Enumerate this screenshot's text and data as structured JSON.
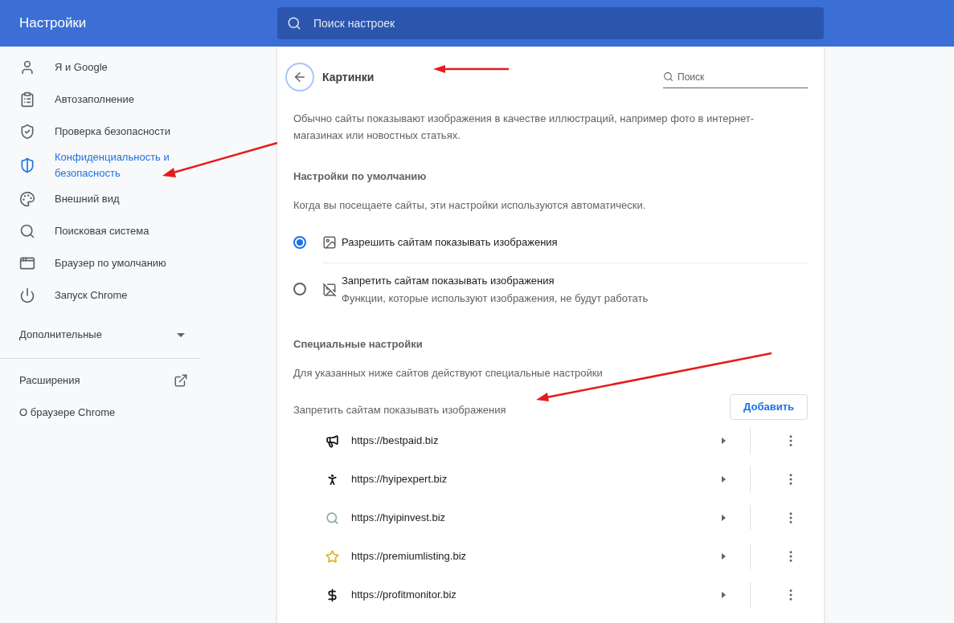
{
  "header": {
    "title": "Настройки",
    "search_placeholder": "Поиск настроек"
  },
  "sidebar": {
    "items": [
      {
        "label": "Я и Google",
        "selected": false
      },
      {
        "label": "Автозаполнение",
        "selected": false
      },
      {
        "label": "Проверка безопасности",
        "selected": false
      },
      {
        "label": "Конфиденциальность и безопасность",
        "selected": true
      },
      {
        "label": "Внешний вид",
        "selected": false
      },
      {
        "label": "Поисковая система",
        "selected": false
      },
      {
        "label": "Браузер по умолчанию",
        "selected": false
      },
      {
        "label": "Запуск Chrome",
        "selected": false
      }
    ],
    "advanced": {
      "label": "Дополнительные",
      "expanded": false
    },
    "extensions": "Расширения",
    "about": "О браузере Chrome"
  },
  "page": {
    "title": "Картинки",
    "search_placeholder": "Поиск",
    "description": "Обычно сайты показывают изображения в качестве иллюстраций, например фото в интернет-магазинах или новостных статьях.",
    "default_section": {
      "heading": "Настройки по умолчанию",
      "description": "Когда вы посещаете сайты, эти настройки используются автоматически.",
      "options": [
        {
          "label": "Разрешить сайтам показывать изображения",
          "selected": true
        },
        {
          "label": "Запретить сайтам показывать изображения",
          "sublabel": "Функции, которые используют изображения, не будут работать",
          "selected": false
        }
      ]
    },
    "custom_section": {
      "heading": "Специальные настройки",
      "description": "Для указанных ниже сайтов действуют специальные настройки",
      "list_title": "Запретить сайтам показывать изображения",
      "add_button": "Добавить",
      "sites": [
        {
          "url": "https://bestpaid.biz"
        },
        {
          "url": "https://hyipexpert.biz"
        },
        {
          "url": "https://hyipinvest.biz"
        },
        {
          "url": "https://premiumlisting.biz"
        },
        {
          "url": "https://profitmonitor.biz"
        }
      ]
    }
  }
}
